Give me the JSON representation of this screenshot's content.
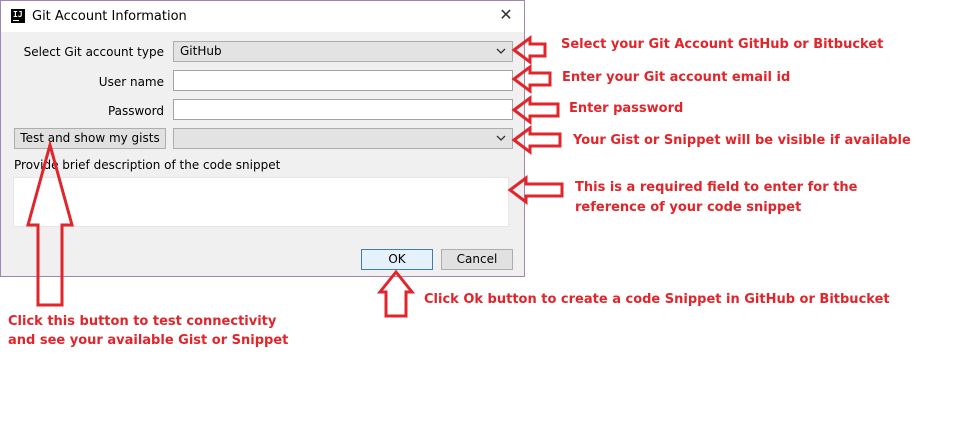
{
  "dialog": {
    "title": "Git Account Information",
    "app_icon_text": "IJ",
    "account_type_label": "Select Git account type",
    "account_type_value": "GitHub",
    "username_label": "User name",
    "username_value": "",
    "password_label": "Password",
    "password_value": "",
    "test_button_label": "Test and show my gists",
    "gists_value": "",
    "description_label": "Provide brief description of the code snippet",
    "description_value": "",
    "ok_label": "OK",
    "cancel_label": "Cancel"
  },
  "annotations": {
    "account_type": "Select your Git Account GitHub or Bitbucket",
    "username": "Enter your Git account email id",
    "password": "Enter password",
    "gists": "Your Gist or Snippet will be visible if available",
    "description_line1": "This is a required field to enter for the",
    "description_line2": "reference of your code snippet",
    "ok": "Click Ok button to create a code Snippet in GitHub or Bitbucket",
    "test_line1": "Click this button to test connectivity",
    "test_line2": "and see your available Gist or Snippet"
  },
  "colors": {
    "annotation": "#e0252b",
    "dialog_bg": "#f0f0f0",
    "window_border": "#9f86b6"
  }
}
